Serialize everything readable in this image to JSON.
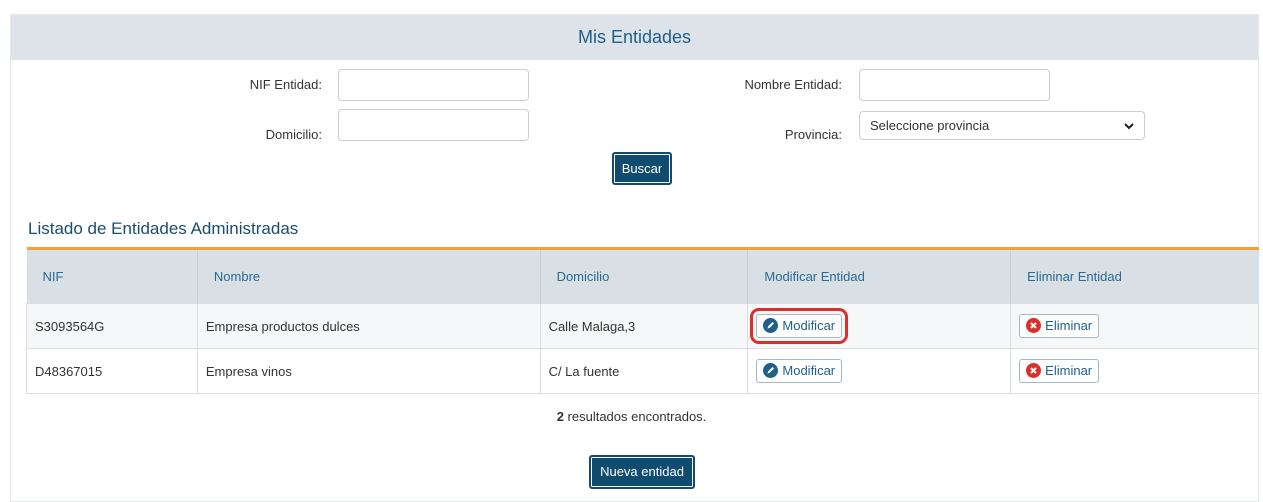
{
  "header": {
    "title": "Mis Entidades"
  },
  "filters": {
    "nif_label": "NIF Entidad:",
    "nif_value": "",
    "nombre_label": "Nombre Entidad:",
    "nombre_value": "",
    "domicilio_label": "Domicilio:",
    "domicilio_value": "",
    "provincia_label": "Provincia:",
    "provincia_selected": "Seleccione provincia",
    "search_button": "Buscar"
  },
  "list": {
    "title": "Listado de Entidades Administradas",
    "columns": [
      "NIF",
      "Nombre",
      "Domicilio",
      "Modificar Entidad",
      "Eliminar Entidad"
    ],
    "rows": [
      {
        "nif": "S3093564G",
        "nombre": "Empresa productos dulces",
        "domicilio": "Calle Malaga,3",
        "modify": "Modificar",
        "delete": "Eliminar"
      },
      {
        "nif": "D48367015",
        "nombre": "Empresa vinos",
        "domicilio": "C/ La fuente",
        "modify": "Modificar",
        "delete": "Eliminar"
      }
    ]
  },
  "results": {
    "count": "2",
    "text": " resultados encontrados."
  },
  "actions": {
    "new_entity": "Nueva entidad"
  },
  "colors": {
    "primary": "#0f4c6f",
    "accent": "#f0a33a",
    "header_bg": "#dde3e8",
    "delete": "#d9302c"
  },
  "icons": {
    "modify": "pencil-icon",
    "delete": "close-circle-icon",
    "select": "chevron-down-icon"
  }
}
